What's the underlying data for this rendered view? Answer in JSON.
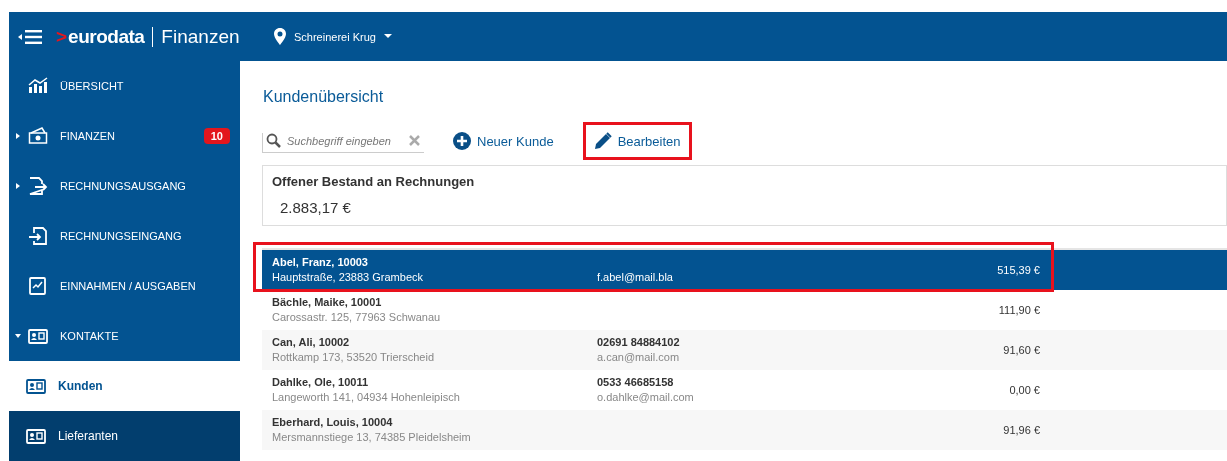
{
  "header": {
    "logo_mark": ">",
    "logo_word": "eurodata",
    "logo_product": "Finanzen",
    "company": "Schreinerei Krug"
  },
  "sidebar": {
    "items": [
      {
        "label": "ÜBERSICHT",
        "selected": false
      },
      {
        "label": "FINANZEN",
        "expanded": false,
        "badge": "10",
        "selected": false
      },
      {
        "label": "RECHNUNGSAUSGANG",
        "expanded": false,
        "selected": false
      },
      {
        "label": "RECHNUNGSEINGANG",
        "selected": false
      },
      {
        "label": "EINNAHMEN / AUSGABEN",
        "selected": false
      },
      {
        "label": "KONTAKTE",
        "expanded": true,
        "selected": false,
        "children": [
          {
            "label": "Kunden",
            "selected": true
          },
          {
            "label": "Lieferanten",
            "selected": false
          }
        ]
      }
    ]
  },
  "main": {
    "title": "Kundenübersicht",
    "search": {
      "placeholder": "Suchbegriff eingeben"
    },
    "actions": [
      {
        "kind": "add",
        "label": "Neuer Kunde",
        "highlighted": false
      },
      {
        "kind": "edit",
        "label": "Bearbeiten",
        "highlighted": true
      }
    ],
    "summary": {
      "title": "Offener Bestand an Rechnungen",
      "value": "2.883,17 €"
    },
    "rows": [
      {
        "name": "Abel, Franz, 10003",
        "address": "Hauptstraße, 23883 Grambeck",
        "email": "f.abel@mail.bla",
        "amount": "515,39 €",
        "selected": true,
        "highlighted": true
      },
      {
        "name": "Bächle, Maike, 10001",
        "address": "Carossastr. 125, 77963 Schwanau",
        "amount": "111,90 €",
        "selected": false,
        "highlighted": false
      },
      {
        "name": "Can, Ali, 10002",
        "address": "Rottkamp  173, 53520 Trierscheid",
        "phone": "02691 84884102",
        "email": "a.can@mail.com",
        "amount": "91,60 €",
        "selected": false,
        "highlighted": false
      },
      {
        "name": "Dahlke, Ole, 10011",
        "address": "Langeworth 141, 04934 Hohenleipisch",
        "phone": "0533 46685158",
        "email": "o.dahlke@mail.com",
        "amount": "0,00 €",
        "selected": false,
        "highlighted": false
      },
      {
        "name": "Eberhard, Louis, 10004",
        "address": "Mersmannstiege 13, 74385 Pleidelsheim",
        "amount": "91,96 €",
        "selected": false,
        "highlighted": false
      }
    ]
  }
}
